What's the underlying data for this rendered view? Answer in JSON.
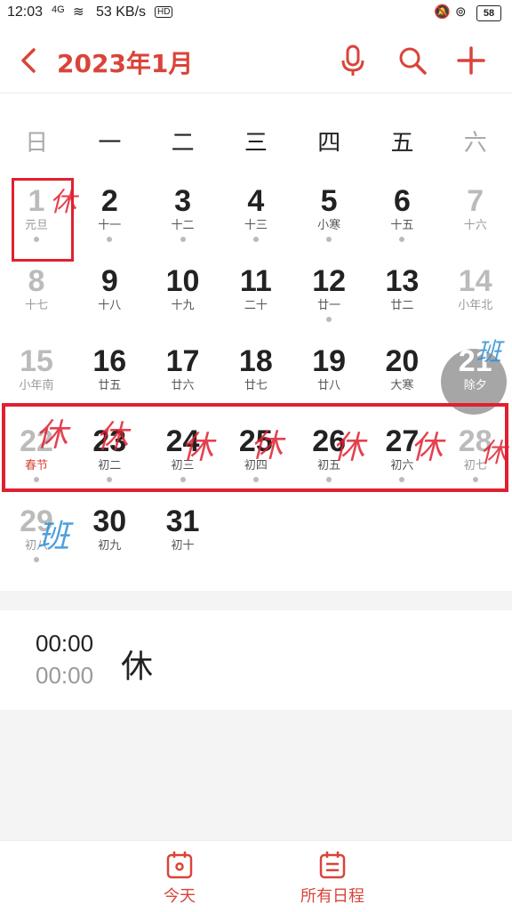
{
  "status_bar": {
    "time": "12:03",
    "signal": "4G",
    "speed": "53 KB/s",
    "hd": "HD",
    "battery": "58"
  },
  "header": {
    "title": "2023年1月"
  },
  "weekdays": [
    "日",
    "一",
    "二",
    "三",
    "四",
    "五",
    "六"
  ],
  "days": [
    {
      "day": "1",
      "sub": "元旦",
      "dot": true
    },
    {
      "day": "2",
      "sub": "十一",
      "dot": true
    },
    {
      "day": "3",
      "sub": "十二",
      "dot": true
    },
    {
      "day": "4",
      "sub": "十三",
      "dot": true
    },
    {
      "day": "5",
      "sub": "小寒",
      "dot": true
    },
    {
      "day": "6",
      "sub": "十五",
      "dot": true
    },
    {
      "day": "7",
      "sub": "十六",
      "dot": false
    },
    {
      "day": "8",
      "sub": "十七",
      "dot": false
    },
    {
      "day": "9",
      "sub": "十八",
      "dot": false
    },
    {
      "day": "10",
      "sub": "十九",
      "dot": false
    },
    {
      "day": "11",
      "sub": "二十",
      "dot": false
    },
    {
      "day": "12",
      "sub": "廿一",
      "dot": true
    },
    {
      "day": "13",
      "sub": "廿二",
      "dot": false
    },
    {
      "day": "14",
      "sub": "小年北",
      "dot": false
    },
    {
      "day": "15",
      "sub": "小年南",
      "dot": false
    },
    {
      "day": "16",
      "sub": "廿五",
      "dot": false
    },
    {
      "day": "17",
      "sub": "廿六",
      "dot": false
    },
    {
      "day": "18",
      "sub": "廿七",
      "dot": false
    },
    {
      "day": "19",
      "sub": "廿八",
      "dot": false
    },
    {
      "day": "20",
      "sub": "大寒",
      "dot": false
    },
    {
      "day": "21",
      "sub": "除夕",
      "dot": false
    },
    {
      "day": "22",
      "sub": "春节",
      "dot": true
    },
    {
      "day": "23",
      "sub": "初二",
      "dot": true
    },
    {
      "day": "24",
      "sub": "初三",
      "dot": true
    },
    {
      "day": "25",
      "sub": "初四",
      "dot": true
    },
    {
      "day": "26",
      "sub": "初五",
      "dot": true
    },
    {
      "day": "27",
      "sub": "初六",
      "dot": true
    },
    {
      "day": "28",
      "sub": "初七",
      "dot": true
    },
    {
      "day": "29",
      "sub": "初八",
      "dot": true
    },
    {
      "day": "30",
      "sub": "初九",
      "dot": false
    },
    {
      "day": "31",
      "sub": "初十",
      "dot": false
    }
  ],
  "annotations": {
    "rest": "休",
    "work": "班"
  },
  "event": {
    "start": "00:00",
    "end": "00:00",
    "title": "休"
  },
  "tabs": {
    "today": "今天",
    "all": "所有日程"
  },
  "colors": {
    "accent": "#d9443a",
    "marker_red": "#e02030",
    "marker_blue": "#2c8fd6"
  }
}
